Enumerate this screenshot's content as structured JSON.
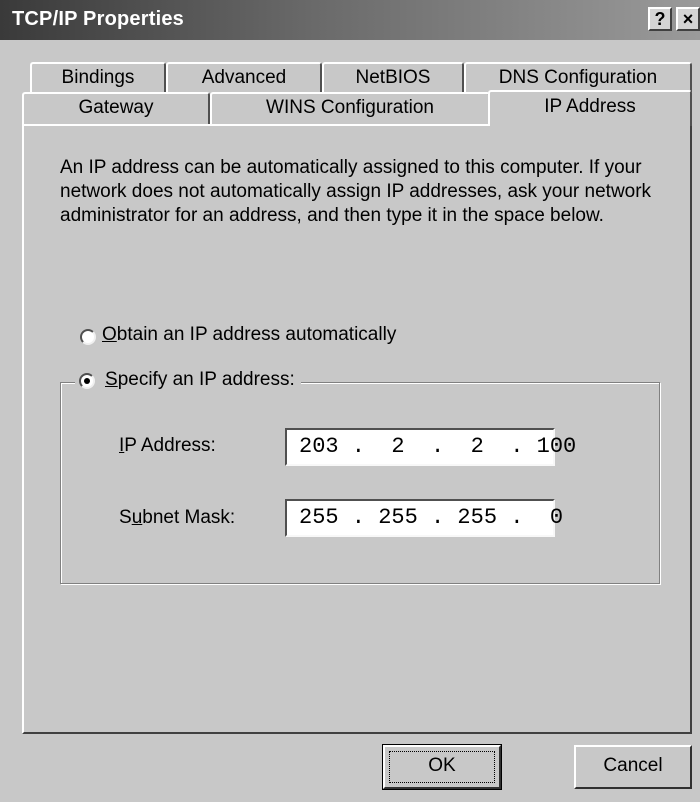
{
  "window": {
    "title": "TCP/IP Properties",
    "help_label": "?",
    "close_label": "×"
  },
  "tabs": {
    "row1": [
      {
        "label": "Bindings"
      },
      {
        "label": "Advanced"
      },
      {
        "label": "NetBIOS"
      },
      {
        "label": "DNS Configuration"
      }
    ],
    "row2": [
      {
        "label": "Gateway"
      },
      {
        "label": "WINS Configuration"
      },
      {
        "label": "IP Address",
        "active": true
      }
    ]
  },
  "panel": {
    "description": "An IP address can be automatically assigned to this computer. If your network does not automatically assign IP addresses, ask your network administrator for an address, and then type it in the space below.",
    "options": {
      "auto": {
        "label_first": "O",
        "label_rest": "btain an IP address automatically",
        "selected": false
      },
      "specify": {
        "label_first": "S",
        "label_rest": "pecify an IP address:",
        "selected": true
      }
    },
    "fields": {
      "ip_address": {
        "label_pre": "",
        "label_key": "I",
        "label_post": "P Address:",
        "value": "203 .  2  .  2  . 100"
      },
      "subnet_mask": {
        "label_pre": "S",
        "label_key": "u",
        "label_post": "bnet Mask:",
        "value": "255 . 255 . 255 .  0"
      }
    }
  },
  "buttons": {
    "ok": "OK",
    "cancel": "Cancel"
  }
}
